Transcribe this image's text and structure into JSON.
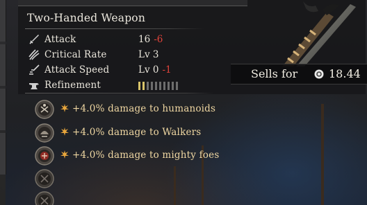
{
  "item": {
    "category": "Two-Handed Weapon"
  },
  "stats": [
    {
      "label": "Attack",
      "value": "16",
      "delta": "-6",
      "icon": "sword-icon"
    },
    {
      "label": "Critical Rate",
      "value": "Lv 3",
      "delta": "",
      "icon": "critical-claw-icon"
    },
    {
      "label": "Attack Speed",
      "value": "Lv 0",
      "delta": "-1",
      "icon": "speed-slash-icon"
    },
    {
      "label": "Refinement",
      "value": "",
      "delta": "",
      "icon": "anvil-icon"
    }
  ],
  "refinement": {
    "level": 2,
    "max": 10
  },
  "sell": {
    "label": "Sells for",
    "value": "18.44",
    "icon": "coin-icon"
  },
  "perks": [
    {
      "text": "+4.0% damage to humanoids",
      "icon": "humanoid-badge-icon"
    },
    {
      "text": "+4.0% damage to Walkers",
      "icon": "walker-badge-icon"
    },
    {
      "text": "+4.0% damage to mighty foes",
      "icon": "mighty-foe-badge-icon"
    },
    {
      "text": "",
      "icon": "empty-perk-slot-icon"
    },
    {
      "text": "",
      "icon": "empty-perk-slot-icon"
    }
  ],
  "colors": {
    "negative_delta": "#e0433b",
    "perk_text": "#efd7a2",
    "refinement_filled": "#d8c36a",
    "refinement_empty": "#6d6d6d"
  }
}
